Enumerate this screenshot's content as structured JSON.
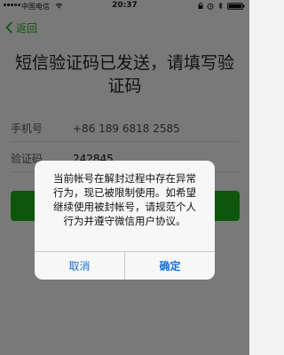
{
  "status_bar": {
    "carrier": "中国电信",
    "time": "20:37"
  },
  "nav": {
    "back_label": "返回"
  },
  "title": {
    "line1": "短信验证码已发送，请填写验",
    "line2": "证码"
  },
  "form": {
    "phone_label": "手机号",
    "phone_value": "+86 189 6818 2585",
    "code_label": "验证码",
    "code_value": "242845"
  },
  "dialog": {
    "line1": "当前帐号在解封过程中存在异常",
    "line2": "行为，现已被限制使用。如希望",
    "line3": "继续使用被封帐号，请规范个人",
    "line4": "行为并遵守微信用户协议。",
    "cancel_label": "取消",
    "confirm_label": "确定"
  },
  "colors": {
    "accent_green": "#1aad19",
    "ios_blue": "#1a6fd6"
  }
}
